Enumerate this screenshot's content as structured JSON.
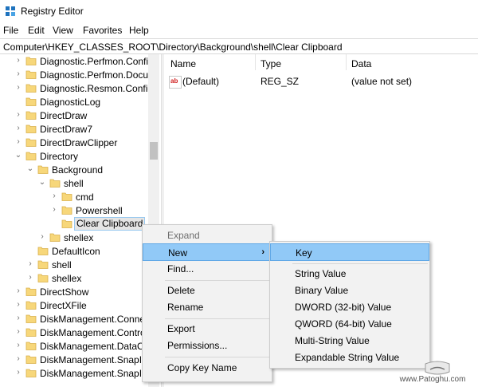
{
  "window": {
    "title": "Registry Editor"
  },
  "menu": {
    "items": [
      "File",
      "Edit",
      "View",
      "Favorites",
      "Help"
    ]
  },
  "address": {
    "path": "Computer\\HKEY_CLASSES_ROOT\\Directory\\Background\\shell\\Clear Clipboard"
  },
  "tree": {
    "items": [
      {
        "label": "Diagnostic.Perfmon.Config",
        "level": 0,
        "arrow": "right"
      },
      {
        "label": "Diagnostic.Perfmon.Document",
        "level": 0,
        "arrow": "right"
      },
      {
        "label": "Diagnostic.Resmon.Config",
        "level": 0,
        "arrow": "right"
      },
      {
        "label": "DiagnosticLog",
        "level": 0,
        "arrow": "none"
      },
      {
        "label": "DirectDraw",
        "level": 0,
        "arrow": "right"
      },
      {
        "label": "DirectDraw7",
        "level": 0,
        "arrow": "right"
      },
      {
        "label": "DirectDrawClipper",
        "level": 0,
        "arrow": "right"
      },
      {
        "label": "Directory",
        "level": 0,
        "arrow": "down"
      },
      {
        "label": "Background",
        "level": 1,
        "arrow": "down"
      },
      {
        "label": "shell",
        "level": 2,
        "arrow": "down"
      },
      {
        "label": "cmd",
        "level": 3,
        "arrow": "right"
      },
      {
        "label": "Powershell",
        "level": 3,
        "arrow": "right"
      },
      {
        "label": "Clear Clipboard",
        "level": 3,
        "arrow": "none",
        "selected": true
      },
      {
        "label": "shellex",
        "level": 2,
        "arrow": "right"
      },
      {
        "label": "DefaultIcon",
        "level": 1,
        "arrow": "none"
      },
      {
        "label": "shell",
        "level": 1,
        "arrow": "right"
      },
      {
        "label": "shellex",
        "level": 1,
        "arrow": "right"
      },
      {
        "label": "DirectShow",
        "level": 0,
        "arrow": "right"
      },
      {
        "label": "DirectXFile",
        "level": 0,
        "arrow": "right"
      },
      {
        "label": "DiskManagement.Connection",
        "level": 0,
        "arrow": "right"
      },
      {
        "label": "DiskManagement.Control",
        "level": 0,
        "arrow": "right"
      },
      {
        "label": "DiskManagement.DataObject",
        "level": 0,
        "arrow": "right"
      },
      {
        "label": "DiskManagement.SnapIn",
        "level": 0,
        "arrow": "right"
      },
      {
        "label": "DiskManagement.SnapIn",
        "level": 0,
        "arrow": "right"
      }
    ]
  },
  "values": {
    "headers": {
      "name": "Name",
      "type": "Type",
      "data": "Data"
    },
    "rows": [
      {
        "name": "(Default)",
        "type": "REG_SZ",
        "data": "(value not set)"
      }
    ]
  },
  "context_menu": {
    "expand": "Expand",
    "new": "New",
    "find": "Find...",
    "delete": "Delete",
    "rename": "Rename",
    "export": "Export",
    "permissions": "Permissions...",
    "copy_key_name": "Copy Key Name"
  },
  "submenu": {
    "key": "Key",
    "string_value": "String Value",
    "binary_value": "Binary Value",
    "dword_value": "DWORD (32-bit) Value",
    "qword_value": "QWORD (64-bit) Value",
    "multi_string_value": "Multi-String Value",
    "expandable_string_value": "Expandable String Value"
  },
  "watermark": {
    "text": "www.Patoghu.com"
  },
  "colors": {
    "folder": "#f7d77a",
    "highlight": "#91c9f7",
    "menu_bg": "#f2f2f2"
  }
}
